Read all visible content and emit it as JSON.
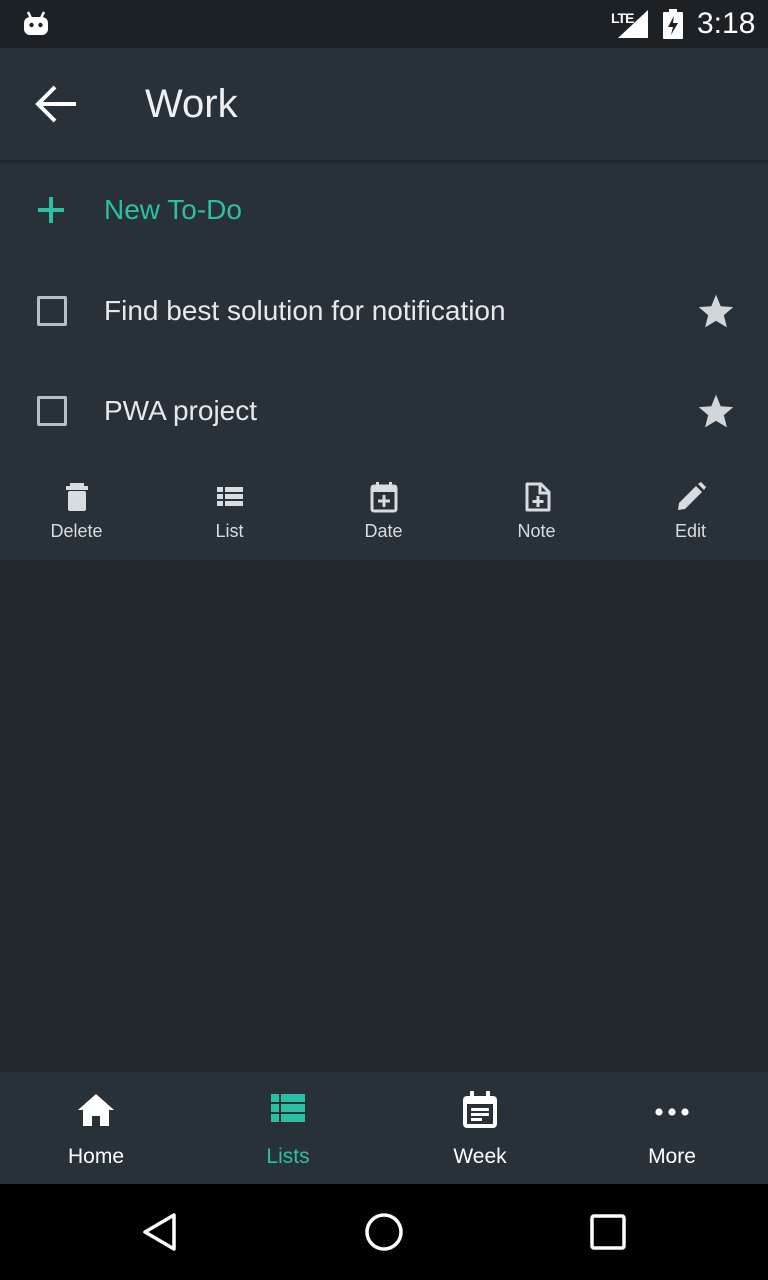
{
  "status_bar": {
    "network": "LTE",
    "time": "3:18"
  },
  "app_bar": {
    "title": "Work",
    "back_icon": "arrow-back-icon"
  },
  "new_todo": {
    "label": "New To-Do",
    "icon": "plus-icon"
  },
  "todos": [
    {
      "text": "Find best solution for notification",
      "checked": false,
      "starred": true
    },
    {
      "text": "PWA project",
      "checked": false,
      "starred": true
    }
  ],
  "actions": [
    {
      "label": "Delete",
      "icon": "trash-icon"
    },
    {
      "label": "List",
      "icon": "list-icon"
    },
    {
      "label": "Date",
      "icon": "calendar-add-icon"
    },
    {
      "label": "Note",
      "icon": "note-add-icon"
    },
    {
      "label": "Edit",
      "icon": "pencil-icon"
    }
  ],
  "bottom_nav": [
    {
      "label": "Home",
      "icon": "home-icon",
      "active": false
    },
    {
      "label": "Lists",
      "icon": "list-icon",
      "active": true
    },
    {
      "label": "Week",
      "icon": "week-calendar-icon",
      "active": false
    },
    {
      "label": "More",
      "icon": "more-dots-icon",
      "active": false
    }
  ],
  "colors": {
    "accent": "#2bbfa4",
    "background": "#23282d",
    "surface": "#283138",
    "status_bar": "#1c2126"
  }
}
